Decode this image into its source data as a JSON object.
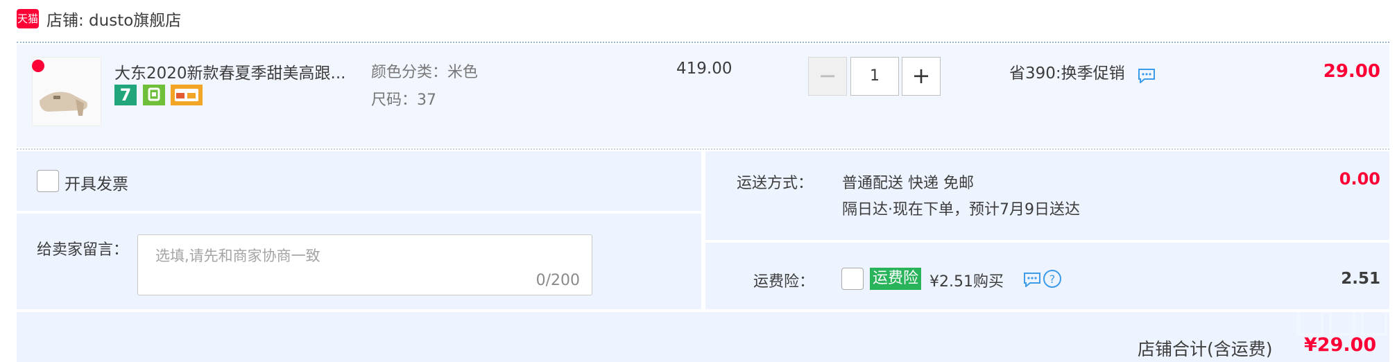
{
  "store": {
    "badge_text": "天猫",
    "name": "店铺: dusto旗舰店"
  },
  "item": {
    "title": "大东2020新款春夏季甜美高跟...",
    "service_icon_7": "7",
    "service_icons": [
      "seven-day-return-icon",
      "shield-icon",
      "card-icon"
    ],
    "sku_color": "颜色分类：米色",
    "sku_size": "尺码：37",
    "unit_price": "419.00",
    "quantity": {
      "minus": "−",
      "value": "1",
      "plus": "+"
    },
    "promo": "省390:换季促销",
    "total": "29.00"
  },
  "invoice": {
    "label": "开具发票"
  },
  "message": {
    "label": "给卖家留言：",
    "placeholder": "选填,请先和商家协商一致",
    "count": "0/200"
  },
  "shipping": {
    "label": "运送方式：",
    "method": "普通配送 快递 免邮",
    "eta": "隔日达·现在下单，预计7月9日送达",
    "fee": "0.00"
  },
  "insurance": {
    "label": "运费险：",
    "tag": "运费险",
    "price": "¥2.51购买",
    "amount": "2.51"
  },
  "footer": {
    "label": "店铺合计(含运费)",
    "amount": "¥29.00"
  },
  "colors": {
    "accent_red": "#ff0036",
    "panel_blue": "#eef4ff",
    "item_blue": "#f2f7ff",
    "insurance_green": "#29b35b",
    "link_blue": "#3c9be8"
  }
}
